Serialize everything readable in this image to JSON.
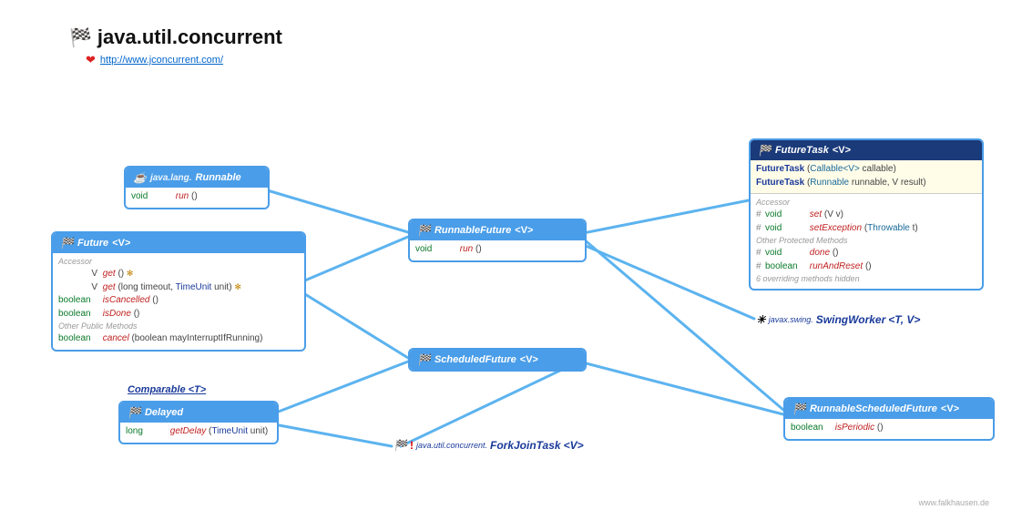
{
  "title": "java.util.concurrent",
  "link": "http://www.jconcurrent.com/",
  "footer": "www.falkhausen.de",
  "comparable": "Comparable <T>",
  "runnable": {
    "pkg": "java.lang.",
    "name": "Runnable",
    "m1_ret": "void",
    "m1": "run",
    "m1_p": "()"
  },
  "future": {
    "name": "Future",
    "tparam": "<V>",
    "sec1": "Accessor",
    "m1_ret": "V",
    "m1": "get",
    "m1_p": "()",
    "m1_th": "✻",
    "m2_ret": "V",
    "m2": "get",
    "m2_p": "(long timeout, TimeUnit unit)",
    "m2_th": "✻",
    "m3_ret": "boolean",
    "m3": "isCancelled",
    "m3_p": "()",
    "m4_ret": "boolean",
    "m4": "isDone",
    "m4_p": "()",
    "sec2": "Other Public Methods",
    "m5_ret": "boolean",
    "m5": "cancel",
    "m5_p": "(boolean mayInterruptIfRunning)"
  },
  "delayed": {
    "name": "Delayed",
    "m1_ret": "long",
    "m1": "getDelay",
    "m1_p": "(TimeUnit unit)"
  },
  "runnablefuture": {
    "name": "RunnableFuture",
    "tparam": "<V>",
    "m1_ret": "void",
    "m1": "run",
    "m1_p": "()"
  },
  "scheduledfuture": {
    "name": "ScheduledFuture",
    "tparam": "<V>"
  },
  "futuretask": {
    "name": "FutureTask",
    "tparam": "<V>",
    "c1": "FutureTask",
    "c1_p": "(Callable<V> callable)",
    "c2": "FutureTask",
    "c2_p": "(Runnable runnable, V result)",
    "sec1": "Accessor",
    "m1_v": "#",
    "m1_ret": "void",
    "m1": "set",
    "m1_p": "(V v)",
    "m2_v": "#",
    "m2_ret": "void",
    "m2": "setException",
    "m2_p": "(Throwable t)",
    "sec2": "Other Protected Methods",
    "m3_v": "#",
    "m3_ret": "void",
    "m3": "done",
    "m3_p": "()",
    "m4_v": "#",
    "m4_ret": "boolean",
    "m4": "runAndReset",
    "m4_p": "()",
    "hidden": "6 overriding methods hidden"
  },
  "rsf": {
    "name": "RunnableScheduledFuture",
    "tparam": "<V>",
    "m1_ret": "boolean",
    "m1": "isPeriodic",
    "m1_p": "()"
  },
  "swing": {
    "pkg": "javax.swing.",
    "name": "SwingWorker",
    "tp": "<T, V>"
  },
  "fjt": {
    "pkg": "java.util.concurrent.",
    "name": "ForkJoinTask",
    "tp": "<V>"
  }
}
